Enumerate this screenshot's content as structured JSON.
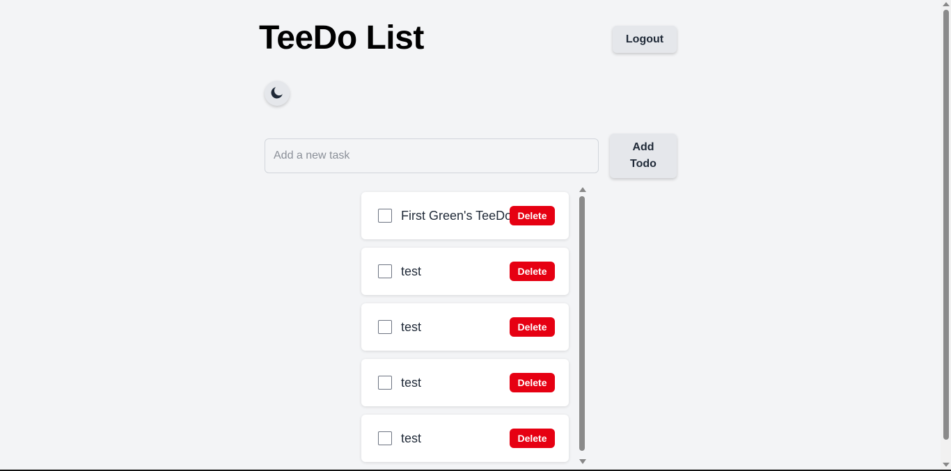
{
  "header": {
    "title": "TeeDo List",
    "logout_label": "Logout"
  },
  "theme_toggle": {
    "icon": "moon-icon"
  },
  "new_task": {
    "placeholder": "Add a new task",
    "value": "",
    "add_label": "Add Todo"
  },
  "todos": [
    {
      "text": "First Green's TeeDo",
      "completed": false,
      "delete_label": "Delete"
    },
    {
      "text": "test",
      "completed": false,
      "delete_label": "Delete"
    },
    {
      "text": "test",
      "completed": false,
      "delete_label": "Delete"
    },
    {
      "text": "test",
      "completed": false,
      "delete_label": "Delete"
    },
    {
      "text": "test",
      "completed": false,
      "delete_label": "Delete"
    }
  ],
  "colors": {
    "background": "#f3f4f6",
    "delete": "#e60012",
    "button_bg": "#e5e7eb"
  }
}
